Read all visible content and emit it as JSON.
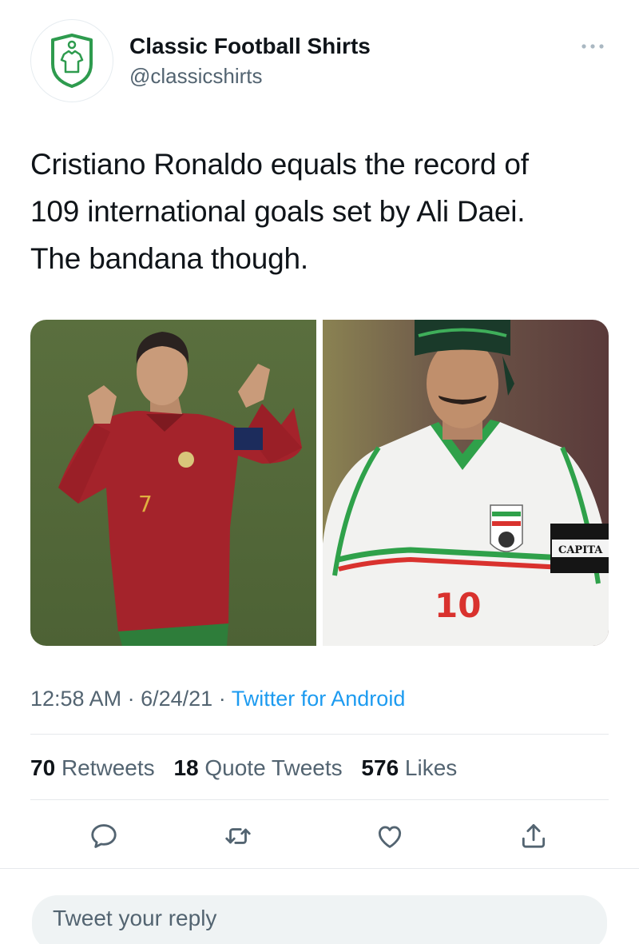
{
  "account": {
    "display_name": "Classic Football Shirts",
    "handle": "@classicshirts",
    "avatar_icon": "shirt-logo-icon",
    "brand_color": "#2e9b4e"
  },
  "tweet": {
    "text_lines": [
      "Cristiano Ronaldo equals the record of",
      "109 international goals set by Ali Daei.",
      "The bandana though."
    ],
    "media": [
      {
        "name": "ronaldo-photo"
      },
      {
        "name": "daei-photo",
        "captain_band_text": "CAPITA",
        "shirt_number": "10"
      }
    ],
    "time": "12:58 AM",
    "date": "6/24/21",
    "separator": "·",
    "source": "Twitter for Android"
  },
  "stats": {
    "retweets_count": "70",
    "retweets_label": "Retweets",
    "quotes_count": "18",
    "quotes_label": "Quote Tweets",
    "likes_count": "576",
    "likes_label": "Likes"
  },
  "actions": [
    {
      "name": "reply-icon"
    },
    {
      "name": "retweet-icon"
    },
    {
      "name": "like-icon"
    },
    {
      "name": "share-icon"
    }
  ],
  "reply": {
    "placeholder": "Tweet your reply"
  },
  "colors": {
    "text_primary": "#0f1419",
    "text_secondary": "#536471",
    "link": "#1d9bf0",
    "divider": "#e6e9ec",
    "action_icon": "#536471"
  }
}
